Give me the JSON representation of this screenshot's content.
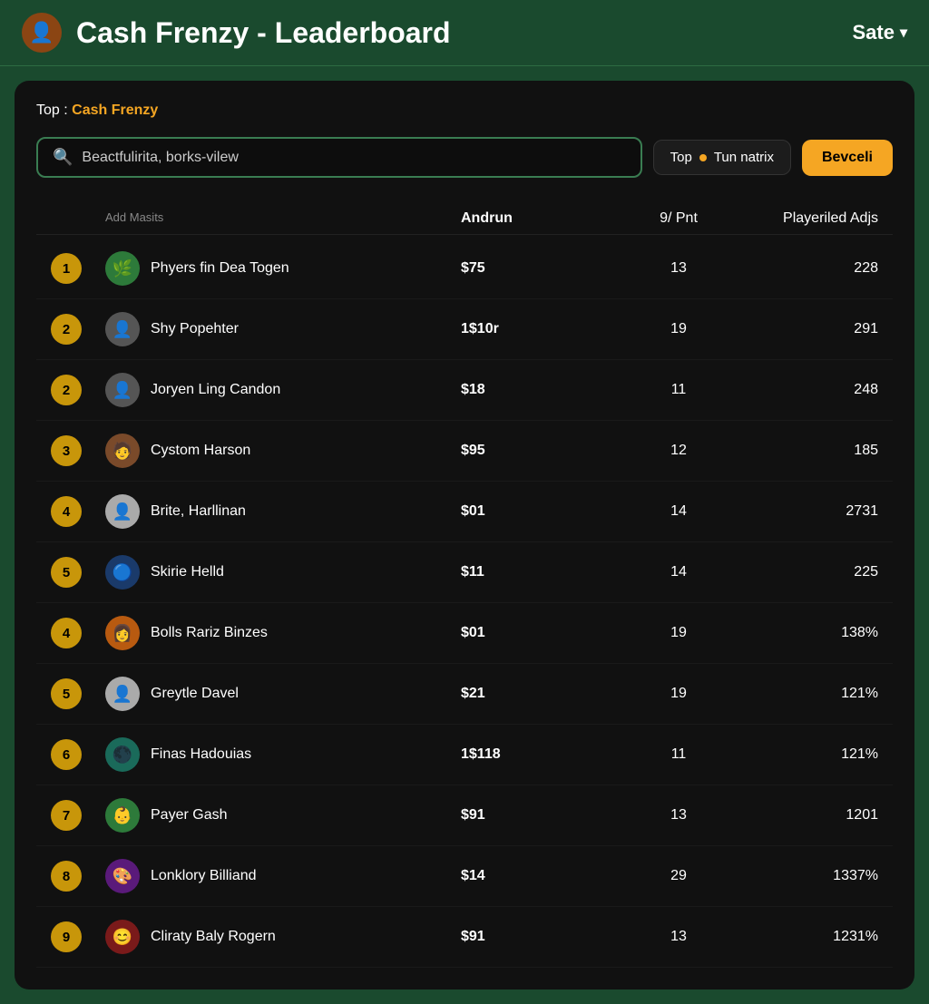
{
  "header": {
    "title": "Cash Frenzy - Leaderboard",
    "action_label": "Sate",
    "logo_emoji": "👤"
  },
  "breadcrumb": {
    "prefix": "Top : ",
    "highlight": "Cash Frenzy"
  },
  "search": {
    "placeholder": "Beactfulirita, borks-vilew",
    "value": "Beactfulirita, borks-vilew"
  },
  "filter": {
    "label": "Top",
    "sub_label": "Tun natrix"
  },
  "button": {
    "label": "Bevceli"
  },
  "table": {
    "columns": {
      "rank": "",
      "name": "Add Masits",
      "amount": "Andrun",
      "points": "9/ Pnt",
      "adj": "Playeriled Adjs"
    },
    "rows": [
      {
        "rank": "1",
        "name": "Phyers fin Dea Togen",
        "amount": "$75",
        "points": "13",
        "adj": "228",
        "avatar": "av-green",
        "emoji": "🌿"
      },
      {
        "rank": "2",
        "name": "Shy Popehter",
        "amount": "1$10r",
        "points": "19",
        "adj": "291",
        "avatar": "av-gray",
        "emoji": "👤"
      },
      {
        "rank": "2",
        "name": "Joryen Ling Candon",
        "amount": "$18",
        "points": "11",
        "adj": "248",
        "avatar": "av-gray",
        "emoji": "👤"
      },
      {
        "rank": "3",
        "name": "Cystom Harson",
        "amount": "$95",
        "points": "12",
        "adj": "185",
        "avatar": "av-brown",
        "emoji": "🧑"
      },
      {
        "rank": "4",
        "name": "Brite, Harllinan",
        "amount": "$01",
        "points": "14",
        "adj": "2731",
        "avatar": "av-light",
        "emoji": "👤"
      },
      {
        "rank": "5",
        "name": "Skirie Helld",
        "amount": "$11",
        "points": "14",
        "adj": "225",
        "avatar": "av-blue",
        "emoji": "🔵"
      },
      {
        "rank": "4",
        "name": "Bolls Rariz Binzes",
        "amount": "$01",
        "points": "19",
        "adj": "138%",
        "avatar": "av-orange",
        "emoji": "👩"
      },
      {
        "rank": "5",
        "name": "Greytle Davel",
        "amount": "$21",
        "points": "19",
        "adj": "121%",
        "avatar": "av-light",
        "emoji": "👤"
      },
      {
        "rank": "6",
        "name": "Finas Hadouias",
        "amount": "1$118",
        "points": "11",
        "adj": "121%",
        "avatar": "av-teal",
        "emoji": "🌑"
      },
      {
        "rank": "7",
        "name": "Payer Gash",
        "amount": "$91",
        "points": "13",
        "adj": "1201",
        "avatar": "av-green",
        "emoji": "👶"
      },
      {
        "rank": "8",
        "name": "Lonklory Billiand",
        "amount": "$14",
        "points": "29",
        "adj": "1337%",
        "avatar": "av-purple",
        "emoji": "🎨"
      },
      {
        "rank": "9",
        "name": "Cliraty Baly Rogern",
        "amount": "$91",
        "points": "13",
        "adj": "1231%",
        "avatar": "av-red",
        "emoji": "😊"
      }
    ]
  }
}
